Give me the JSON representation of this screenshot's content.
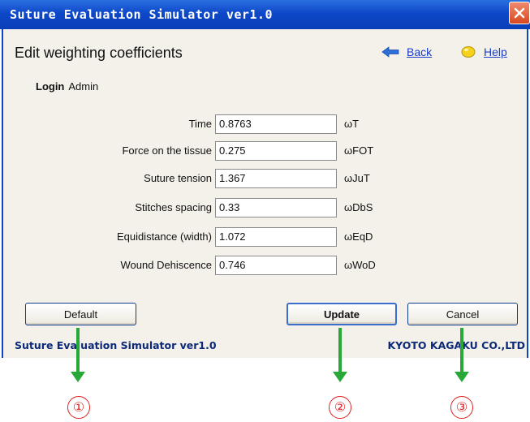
{
  "window": {
    "title": "Suture Evaluation Simulator ver1.0"
  },
  "page": {
    "title": "Edit weighting coefficients",
    "back_label": "Back",
    "help_label": "Help"
  },
  "login": {
    "label": "Login",
    "user": "Admin"
  },
  "fields": [
    {
      "label": "Time",
      "value": "0.8763",
      "unit": "ωT"
    },
    {
      "label": "Force on the tissue",
      "value": "0.275",
      "unit": "ωFOT"
    },
    {
      "label": "Suture tension",
      "value": "1.367",
      "unit": "ωJuT"
    },
    {
      "label": "Stitches spacing",
      "value": "0.33",
      "unit": "ωDbS"
    },
    {
      "label": "Equidistance (width)",
      "value": "1.072",
      "unit": "ωEqD"
    },
    {
      "label": "Wound Dehiscence",
      "value": "0.746",
      "unit": "ωWoD"
    }
  ],
  "buttons": {
    "default": "Default",
    "update": "Update",
    "cancel": "Cancel"
  },
  "footer": {
    "left": "Suture Evaluation Simulator ver1.0",
    "right": "KYOTO KAGAKU CO.,LTD"
  },
  "callouts": [
    "①",
    "②",
    "③"
  ],
  "colors": {
    "titlebar": "#0d48c8",
    "client_bg": "#f3f1ea",
    "link": "#1a3cc8",
    "arrow": "#27a838",
    "callout": "#e02020"
  }
}
